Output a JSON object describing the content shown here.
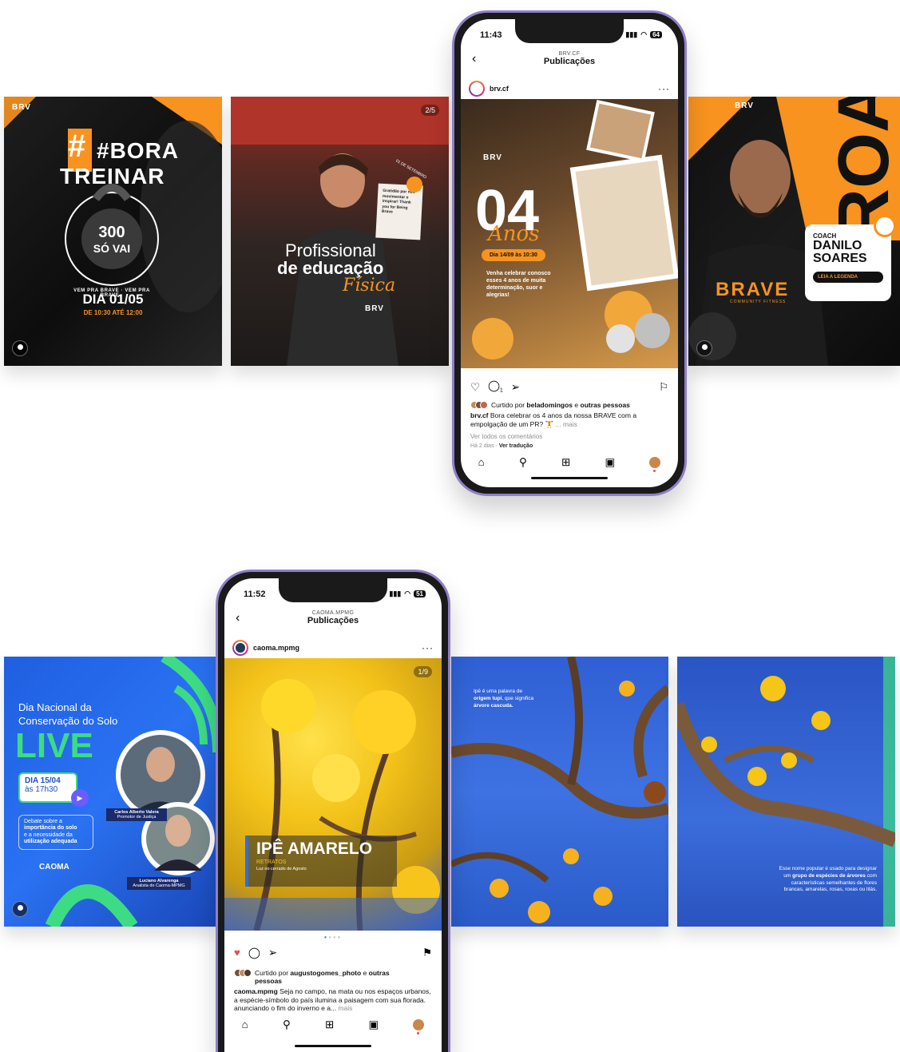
{
  "brave": {
    "card1": {
      "brand": "BRV",
      "hashtag": "#BORA",
      "hashtag2": "TREINAR",
      "badge_top": "300",
      "badge_bottom": "SÓ VAI",
      "ring_text": "VEM PRA BRAVE · VEM PRA BRAVE ·",
      "date": "DIA 01/05",
      "time": "DE 10:30 ATÉ 12:00"
    },
    "card2": {
      "counter": "2/5",
      "line1": "Profissional",
      "line2": "de educação",
      "line3": "Física",
      "note": "Gratidão por nos movimentar e inspirar! Thank you for Being Brave",
      "stamp": "01 DE SETEMBRO",
      "brand": "BRV"
    },
    "card4": {
      "brand": "BRV",
      "label": "COACH",
      "name1": "DANILO",
      "name2": "SOARES",
      "cta": "LEIA A LEGENDA",
      "shirt": "BRAVE",
      "shirt_sub": "COMMUNITY FITNESS"
    }
  },
  "phone1": {
    "time": "11:43",
    "battery": "64",
    "account": "BRV.CF",
    "title": "Publicações",
    "username": "brv.cf",
    "post": {
      "brand": "BRV",
      "number": "04",
      "script": "Anos",
      "pill": "Dia 14/09 às 10:30",
      "body": "Venha celebrar conosco esses 4 anos de muita determinação, suor e alegrias!"
    },
    "comment_count": "1",
    "liked_by_prefix": "Curtido por ",
    "liked_by_user": "beladomingos",
    "liked_by_suffix": " e ",
    "liked_by_others": "outras pessoas",
    "caption_user": "brv.cf",
    "caption_text": " Bora celebrar os 4 anos da nossa BRAVE com a empolgação de um PR? 🏋️",
    "caption_more": "... mais",
    "view_comments": "Ver todos os comentários",
    "ago": "Há 2 dias",
    "translate": "Ver tradução"
  },
  "caoma": {
    "card5": {
      "title1": "Dia Nacional da",
      "title2": "Conservação do Solo",
      "live": "LIVE",
      "date": "DIA 15/04",
      "time": "às 17h30",
      "debate_a": "Debate sobre a",
      "debate_b": "importância do solo",
      "debate_c": "e a necessidade da",
      "debate_d": "utilização adequada",
      "logo": "CAOMA",
      "speaker1_name": "Carlos Alberto Valera",
      "speaker1_role": "Promotor de Justiça",
      "speaker2_name": "Luciano Alvarenga",
      "speaker2_role": "Analista do Caoma-MPMG"
    },
    "card7": {
      "line1": "Ipê é uma palavra de",
      "line2_bold": "origem tupi",
      "line2_rest": ", que significa",
      "line3_bold": "árvore cascuda."
    },
    "card8": {
      "p1": "Esse nome popular é usado para designar um ",
      "p1_bold": "grupo de espécies de árvores",
      "p2": " com características semelhantes de flores brancas, amarelas, rosas, roxas ou lilás."
    }
  },
  "phone2": {
    "time": "11:52",
    "battery": "51",
    "account": "CAOMA.MPMG",
    "title": "Publicações",
    "username": "caoma.mpmg",
    "post": {
      "counter": "1/9",
      "headline": "IPÊ AMARELO",
      "sub": "RETRATOS",
      "sub2": "Luz no cerrado de Agosto"
    },
    "liked_by_prefix": "Curtido por ",
    "liked_by_user": "augustogomes_photo",
    "liked_by_suffix": " e ",
    "liked_by_others": "outras pessoas",
    "caption_user": "caoma.mpmg",
    "caption_text": " Seja no campo, na mata ou nos espaços urbanos, a espécie-símbolo do país ilumina a paisagem com sua florada. anunciando o fim do inverno e a...",
    "caption_more": " mais"
  },
  "colors": {
    "brave_orange": "#f7931e",
    "caoma_blue": "#2a6df0",
    "caoma_green": "#3ddc84",
    "ipe_yellow": "#f5c518",
    "like_red": "#ed4956"
  },
  "icons": [
    "back-chevron-icon",
    "heart-icon",
    "comment-icon",
    "share-icon",
    "bookmark-icon",
    "home-icon",
    "search-icon",
    "new-post-icon",
    "reels-icon",
    "more-dots-icon",
    "play-icon"
  ]
}
